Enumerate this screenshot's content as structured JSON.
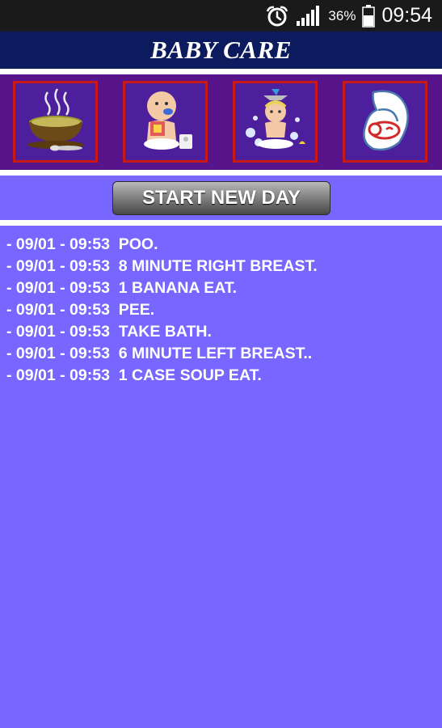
{
  "status_bar": {
    "battery_percent": "36%",
    "time": "09:54",
    "icons": [
      "alarm-clock-icon",
      "signal-icon",
      "battery-icon"
    ]
  },
  "header": {
    "title": "BABY CARE"
  },
  "actions": [
    {
      "id": "soup",
      "icon": "soup-bowl-icon"
    },
    {
      "id": "potty",
      "icon": "baby-potty-icon"
    },
    {
      "id": "bath",
      "icon": "baby-bath-icon"
    },
    {
      "id": "breastfeed",
      "icon": "breastfeeding-icon"
    }
  ],
  "start_button": {
    "label": "START NEW DAY"
  },
  "log": [
    "- 09/01 - 09:53  POO.",
    "- 09/01 - 09:53  8 MINUTE RIGHT BREAST.",
    "- 09/01 - 09:53  1 BANANA EAT.",
    "- 09/01 - 09:53  PEE.",
    "- 09/01 - 09:53  TAKE BATH.",
    "- 09/01 - 09:53  6 MINUTE LEFT BREAST..",
    "- 09/01 - 09:53  1 CASE SOUP EAT."
  ],
  "colors": {
    "background": "#7766ff",
    "header_bg": "#0c1a5e",
    "icon_strip_bg": "#58148a",
    "icon_border": "#c81818"
  }
}
